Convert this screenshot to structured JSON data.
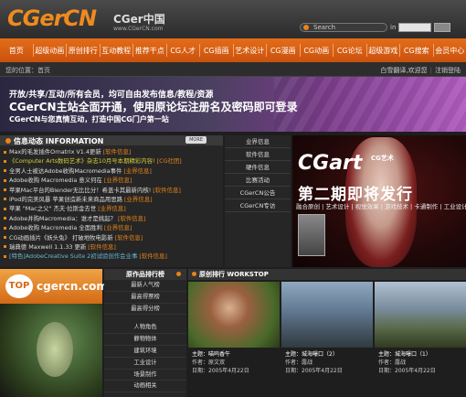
{
  "header": {
    "logo": "CGerCN",
    "logo_cn": "CGer中国",
    "logo_url": "www.CGerCN.com",
    "search_placeholder": "Search",
    "search_in": "in"
  },
  "nav": [
    "首页",
    "超级动画",
    "原创排行",
    "互动教程",
    "推荐干点",
    "CG人才",
    "CG插画",
    "艺术设计",
    "CG漫画",
    "CG动画",
    "CG论坛",
    "超级游戏",
    "CG搜索",
    "会员中心"
  ],
  "subbar": {
    "left": "您的位置：首页",
    "right_1": "白雪翻译,欢迎您",
    "right_2": "注销登陆"
  },
  "banner": {
    "line1": "开放/共享/互动/所有会员，均可自由发布信息/教程/资源",
    "line2": "CGerCN主站全面开通，使用原论坛注册名及密码即可登录",
    "line3": "CGerCN与您真情互动，打造中国CG门户第一站"
  },
  "news": {
    "title": "信息动态 INFORMATION",
    "more": "MORE",
    "items": [
      {
        "text": "Max的毛发插件Ornatrix V1.4更新",
        "tag": "[软件信息]",
        "cls": ""
      },
      {
        "text": "《Computer Arts数码艺术》杂志10月号本期精彩内容!",
        "tag": "[CG社团]",
        "cls": "hl"
      },
      {
        "text": "全男人士被达Adobe收购Macromedia事件",
        "tag": "[业界信息]",
        "cls": ""
      },
      {
        "text": "Adobe收购 Macromedia 意义何在",
        "tag": "[业界信息]",
        "cls": ""
      },
      {
        "text": "苹果Mac平台的Blender无比比分！希盖卡其最新内核!",
        "tag": "[软件信息]",
        "cls": ""
      },
      {
        "text": "iPod的完美风暴 苹果创造新未来商品用思路",
        "tag": "[业界信息]",
        "cls": ""
      },
      {
        "text": "苹果 \"Mac之父\" 杰夫·拉斯金去世",
        "tag": "[业界信息]",
        "cls": ""
      },
      {
        "text": "Adobe并购Macromedia：谁才是挑起？",
        "tag": "[软件信息]",
        "cls": ""
      },
      {
        "text": "Adobe收购 Macromedia 全面胜利",
        "tag": "[业界信息]",
        "cls": ""
      },
      {
        "text": "CG动画插片《妖头兔》 打破地牧电影新",
        "tag": "[软件信息]",
        "cls": ""
      },
      {
        "text": "瑞典德 Maxwell 1.1.33 更新",
        "tag": "[软件信息]",
        "cls": ""
      },
      {
        "text": "[特色]AdobeCreative Suite 2初试验创作会业事",
        "tag": "[软件信息]",
        "cls": "cyan"
      }
    ]
  },
  "mid": [
    "业界信息",
    "软件信息",
    "硬件信息",
    "比赛活动",
    "CGerCN公告",
    "CGerCN专访"
  ],
  "magazine": {
    "logo": "CGart",
    "logo_sub": "CG艺术",
    "headline": "第二期即将发行",
    "tagline": "融合原创 | 艺术设计 | 视觉效果 | 游戏技术 | 卡通制作 | 工业设计"
  },
  "top_logo": {
    "badge": "TOP",
    "site": "cgercn.com"
  },
  "rank": {
    "title": "原作品排行榜",
    "group1": [
      "最新人气榜",
      "最高得票榜",
      "最高得分榜"
    ],
    "group2": [
      "人物角色",
      "静物物体",
      "建筑环境",
      "工业设计",
      "场景制作",
      "动画相关"
    ]
  },
  "works": {
    "title": "原创排行 WORKSTOP",
    "items": [
      {
        "title": "主题：喵呜香午",
        "author": "作者：原文双",
        "date": "日期：2005年4月22日"
      },
      {
        "title": "主题：城海曝口（2）",
        "author": "作者：露战",
        "date": "日期：2005年4月22日"
      },
      {
        "title": "主题：城海曝口（1）",
        "author": "作者：露战",
        "date": "日期：2005年4月22日"
      }
    ]
  }
}
